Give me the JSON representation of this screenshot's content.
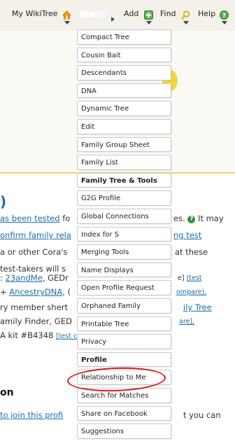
{
  "nav": {
    "brand": "My WikiTree",
    "add": "Add",
    "find": "Find",
    "help": "Help"
  },
  "menu": {
    "items": [
      {
        "label": "Compact Tree",
        "bold": false
      },
      {
        "label": "Cousin Bait",
        "bold": false
      },
      {
        "label": "Descendants",
        "bold": false
      },
      {
        "label": "DNA",
        "bold": false
      },
      {
        "label": "Dynamic Tree",
        "bold": false
      },
      {
        "label": "Edit",
        "bold": false
      },
      {
        "label": "Family Group Sheet",
        "bold": false
      },
      {
        "label": "Family List",
        "bold": false
      },
      {
        "label": "Family Tree & Tools",
        "bold": true
      },
      {
        "label": "G2G Profile",
        "bold": false
      },
      {
        "label": "Global Connections",
        "bold": false
      },
      {
        "label": "Index for S",
        "bold": false
      },
      {
        "label": "Merging Tools",
        "bold": false
      },
      {
        "label": "Name Displays",
        "bold": false
      },
      {
        "label": "Open Profile Request",
        "bold": false
      },
      {
        "label": "Orphaned Family",
        "bold": false
      },
      {
        "label": "Printable Tree",
        "bold": false
      },
      {
        "label": "Privacy",
        "bold": false
      },
      {
        "label": "Profile",
        "bold": true
      },
      {
        "label": "Relationship to Me",
        "bold": false
      },
      {
        "label": "Search for Matches",
        "bold": false
      },
      {
        "label": "Share on Facebook",
        "bold": false
      },
      {
        "label": "Suggestions",
        "bold": false
      }
    ]
  },
  "background": {
    "line1_link": "as been tested",
    "line1_text": " fo",
    "line1_right": "es.",
    "line1_right2": " It may",
    "line2_link": "onfirm family rela",
    "line2_right_link": "ng test",
    "line3_left": "a or other Cora's",
    "line3_right": "at these",
    "line4_left": "test-takers will s",
    "line5_left": ": ",
    "line5_link": "23andMe",
    "line5_rest": ", GEDr",
    "line5_right1": "e] ",
    "line5_right2": "(test",
    "line6_left": " + ",
    "line6_link": "AncestryDNA",
    "line6_rest": ", (",
    "line6_right": "ompare),",
    "line7_left": "ry member shert",
    "line7_right": "ily Tree",
    "line8_left": "amily Finder, GED",
    "line8_right": "are],",
    "line9_left": "A kit #B4348 ",
    "line9_link": "[test c",
    "heading_fragment": "on",
    "line10_link": " to join this profi",
    "line10_right": "t you can",
    "paren": ")",
    "help_glyph": "?"
  },
  "colors": {
    "accent_green": "#3e8e3e",
    "link_blue": "#1a6fa8",
    "highlight_red": "#e0131b",
    "yellow": "#f5d63a"
  }
}
